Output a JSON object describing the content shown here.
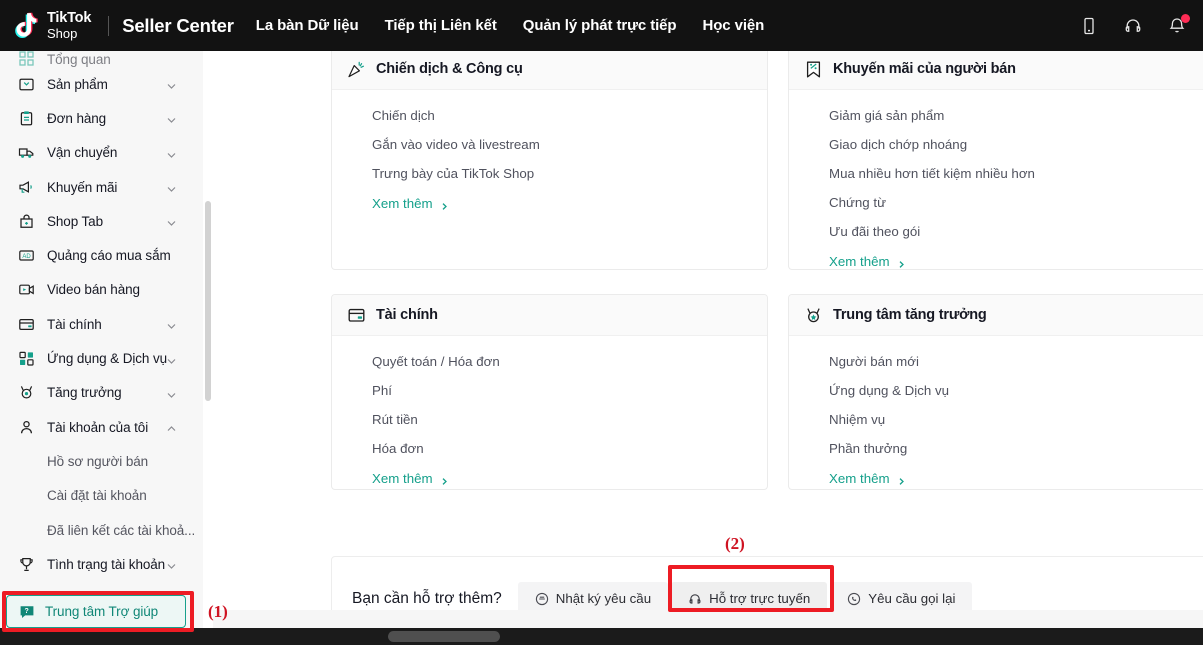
{
  "header": {
    "brand_line1": "TikTok",
    "brand_line2": "Shop",
    "seller_center": "Seller Center",
    "nav": [
      {
        "label": "La bàn Dữ liệu"
      },
      {
        "label": "Tiếp thị Liên kết"
      },
      {
        "label": "Quản lý phát trực tiếp"
      },
      {
        "label": "Học viện"
      }
    ],
    "icons": [
      {
        "name": "mobile-icon"
      },
      {
        "name": "headset-icon"
      },
      {
        "name": "bell-icon",
        "badge": true
      }
    ]
  },
  "sidebar": {
    "items": [
      {
        "label": "Tổng quan",
        "icon": "grid-icon",
        "chevron": false,
        "cut": true
      },
      {
        "label": "Sản phẩm",
        "icon": "box-icon",
        "chevron": true
      },
      {
        "label": "Đơn hàng",
        "icon": "clipboard-icon",
        "chevron": true
      },
      {
        "label": "Vận chuyển",
        "icon": "truck-icon",
        "chevron": true
      },
      {
        "label": "Khuyến mãi",
        "icon": "megaphone-icon",
        "chevron": true
      },
      {
        "label": "Shop Tab",
        "icon": "bag-icon",
        "chevron": true
      },
      {
        "label": "Quảng cáo mua sắm",
        "icon": "ad-icon",
        "chevron": false
      },
      {
        "label": "Video bán hàng",
        "icon": "video-icon",
        "chevron": false
      },
      {
        "label": "Tài chính",
        "icon": "card-icon",
        "chevron": true
      },
      {
        "label": "Ứng dụng & Dịch vụ",
        "icon": "apps-icon",
        "chevron": true
      },
      {
        "label": "Tăng trưởng",
        "icon": "medal-icon",
        "chevron": true
      },
      {
        "label": "Tài khoản của tôi",
        "icon": "user-icon",
        "chevron": true,
        "expanded": true
      }
    ],
    "sub_items": [
      {
        "label": "Hồ sơ người bán"
      },
      {
        "label": "Cài đặt tài khoản"
      },
      {
        "label": "Đã liên kết các tài khoả..."
      }
    ],
    "account_health": {
      "label": "Tình trạng tài khoản",
      "icon": "trophy-icon",
      "chevron": true
    },
    "help_center": {
      "label": "Trung tâm Trợ giúp",
      "icon": "help-chat-icon"
    }
  },
  "annotations": [
    {
      "number": "(1)"
    },
    {
      "number": "(2)"
    }
  ],
  "colors": {
    "accent_teal": "#15a08b",
    "annotation_red": "#ed1c24",
    "brand_pink": "#fe2c55",
    "header_dark": "#121212"
  },
  "cards": [
    {
      "title": "Chiến dịch & Công cụ",
      "icon": "party-popper-icon",
      "links": [
        "Chiến dịch",
        "Gắn vào video và livestream",
        "Trưng bày của TikTok Shop"
      ],
      "more": "Xem thêm"
    },
    {
      "title": "Khuyến mãi của người bán",
      "icon": "discount-tag-icon",
      "links": [
        "Giảm giá sản phẩm",
        "Giao dịch chớp nhoáng",
        "Mua nhiều hơn tiết kiệm nhiều hơn",
        "Chứng từ",
        "Ưu đãi theo gói"
      ],
      "more": "Xem thêm"
    },
    {
      "title": "Tài chính",
      "icon": "finance-card-icon",
      "links": [
        "Quyết toán / Hóa đơn",
        "Phí",
        "Rút tiền",
        "Hóa đơn"
      ],
      "more": "Xem thêm"
    },
    {
      "title": "Trung tâm tăng trưởng",
      "icon": "growth-medal-icon",
      "links": [
        "Người bán mới",
        "Ứng dụng & Dịch vụ",
        "Nhiệm vụ",
        "Phần thưởng"
      ],
      "more": "Xem thêm"
    }
  ],
  "support": {
    "question": "Bạn cần hỗ trợ thêm?",
    "buttons": [
      {
        "label": "Nhật ký yêu cầu",
        "icon": "ticket-log-icon",
        "active": false
      },
      {
        "label": "Hỗ trợ trực tuyến",
        "icon": "headset-icon",
        "active": true
      },
      {
        "label": "Yêu cầu gọi lại",
        "icon": "phone-icon",
        "active": false
      }
    ]
  }
}
